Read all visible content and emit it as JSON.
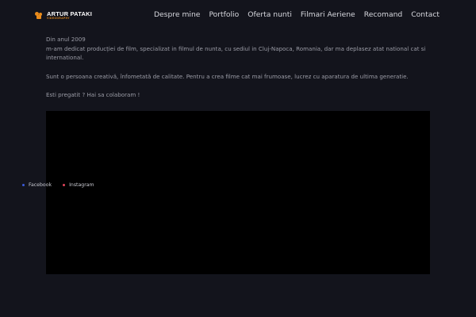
{
  "brand": {
    "name": "ARTUR PATAKI",
    "subtitle": "VIDEOGRAPHY",
    "accent_color": "#e98b1b",
    "icon": "film-reel-icon"
  },
  "nav": {
    "items": [
      {
        "label": "Despre mine"
      },
      {
        "label": "Portfolio"
      },
      {
        "label": "Oferta nunti"
      },
      {
        "label": "Filmari Aeriene"
      },
      {
        "label": "Recomand"
      },
      {
        "label": "Contact"
      }
    ]
  },
  "about": {
    "line1": "Din anul 2009",
    "line2": "m-am dedicat producției de film, specializat in filmul de nunta, cu sediul in Cluj-Napoca, Romania, dar ma deplasez atat national cat si international.",
    "paragraph2": "Sunt o persoana creativă, înfometată de calitate. Pentru a crea filme cat mai frumoase, lucrez cu aparatura de ultima generatie.",
    "paragraph3": "Esti pregatit ? Hai sa colaboram !"
  },
  "social": {
    "items": [
      {
        "label": "Facebook",
        "color": "#3b5bdb",
        "icon": "facebook-dot-icon"
      },
      {
        "label": "Instagram",
        "color": "#e0445a",
        "icon": "instagram-dot-icon"
      }
    ]
  }
}
